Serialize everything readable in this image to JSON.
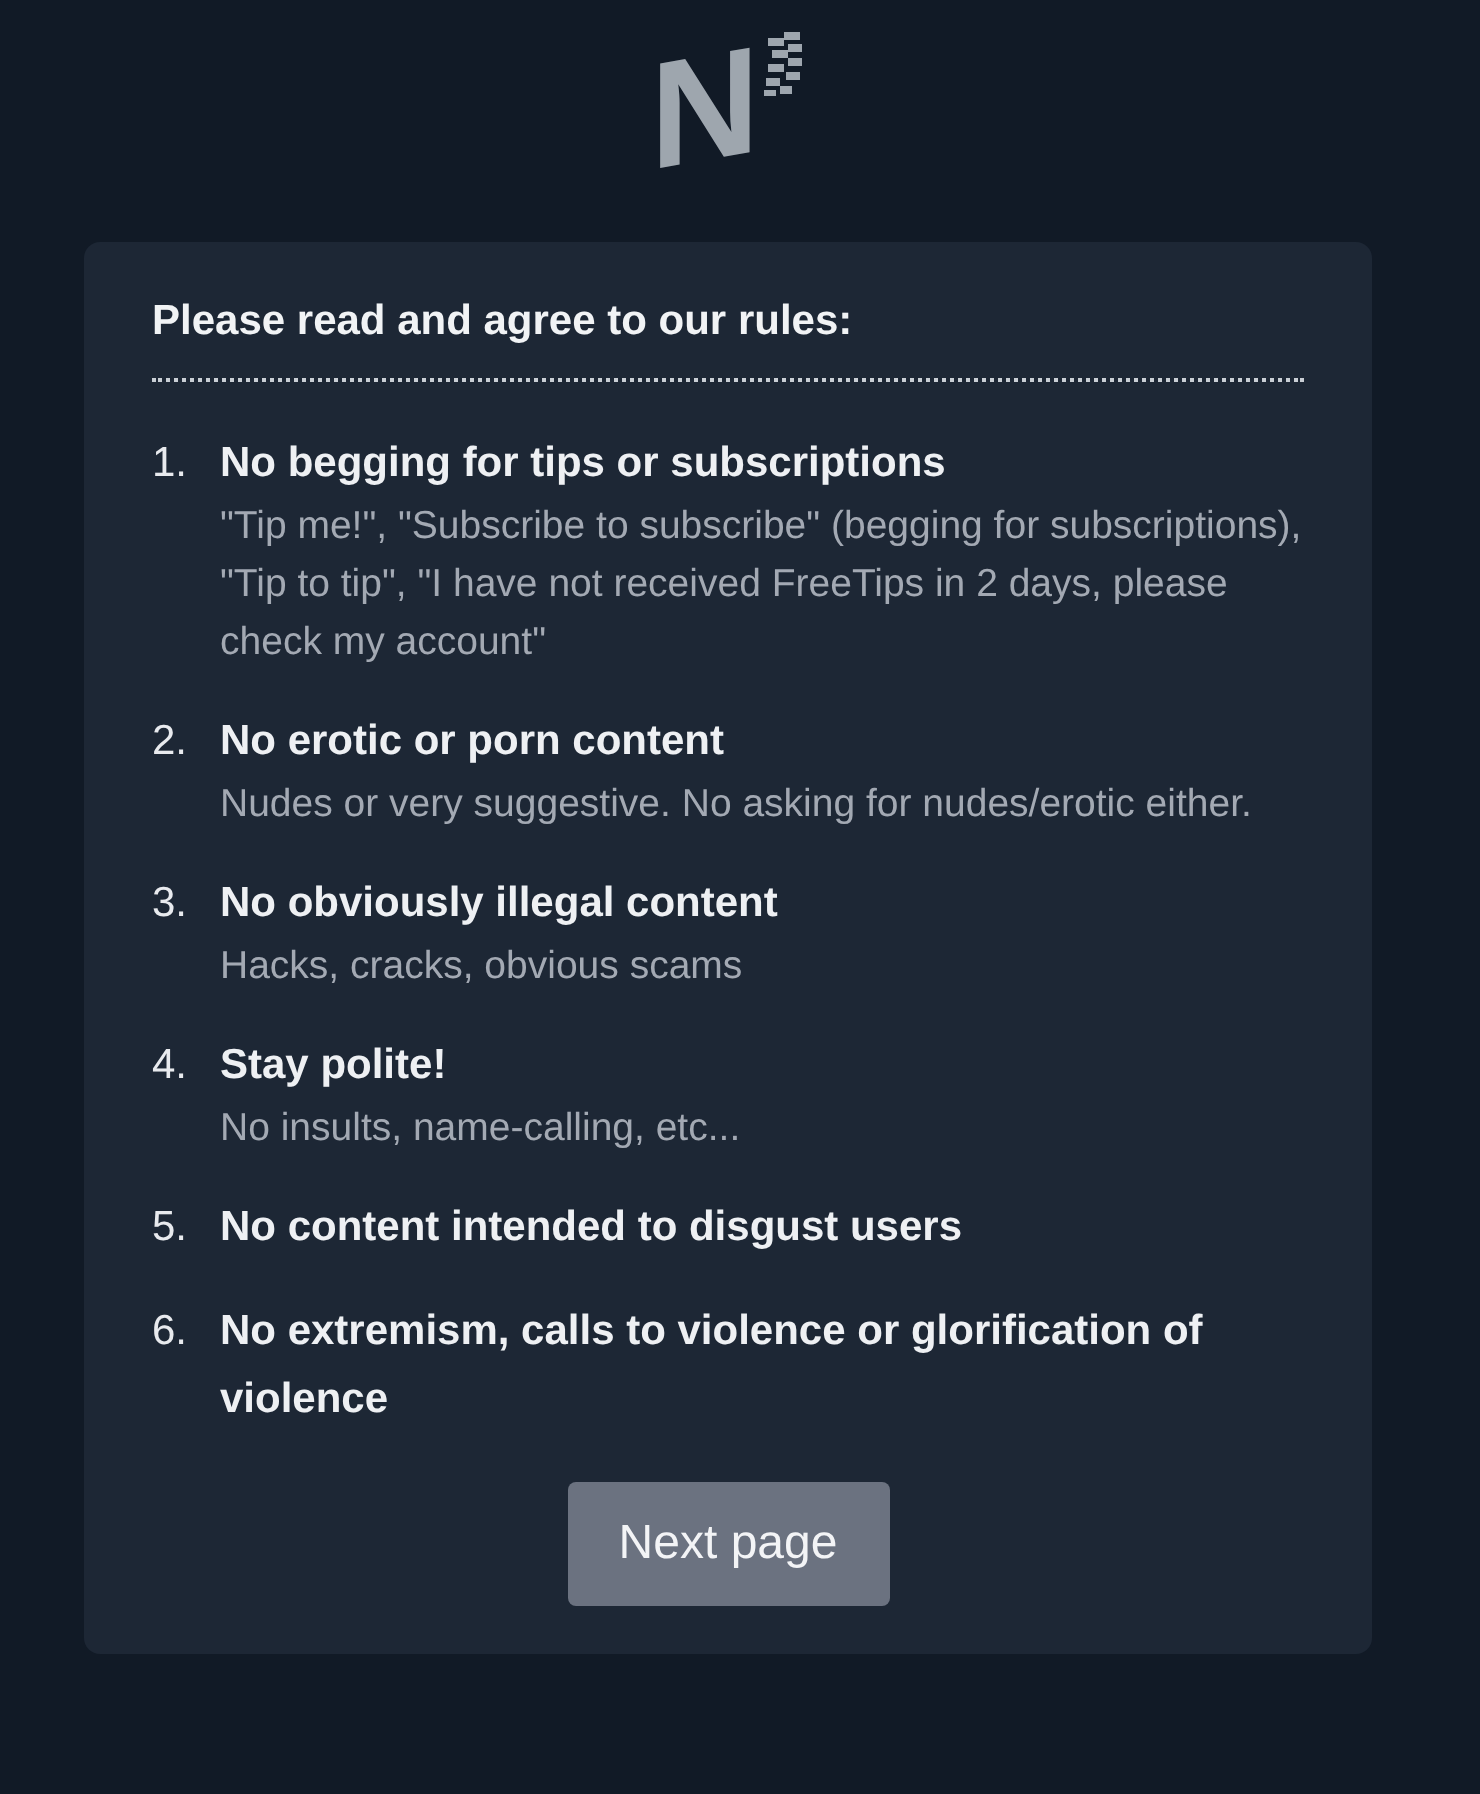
{
  "logo": {
    "letter": "N"
  },
  "heading": "Please read and agree to our rules:",
  "rules": [
    {
      "number": "1.",
      "title": "No begging for tips or subscriptions",
      "description": "\"Tip me!\", \"Subscribe to subscribe\" (begging for subscriptions), \"Tip to tip\", \"I have not received FreeTips in 2 days, please check my account\""
    },
    {
      "number": "2.",
      "title": "No erotic or porn content",
      "description": "Nudes or very suggestive. No asking for nudes/erotic either."
    },
    {
      "number": "3.",
      "title": "No obviously illegal content",
      "description": "Hacks, cracks, obvious scams"
    },
    {
      "number": "4.",
      "title": "Stay polite!",
      "description": "No insults, name-calling, etc..."
    },
    {
      "number": "5.",
      "title": "No content intended to disgust users"
    },
    {
      "number": "6.",
      "title": "No extremism, calls to violence or glorification of violence"
    }
  ],
  "button": {
    "label": "Next page"
  }
}
